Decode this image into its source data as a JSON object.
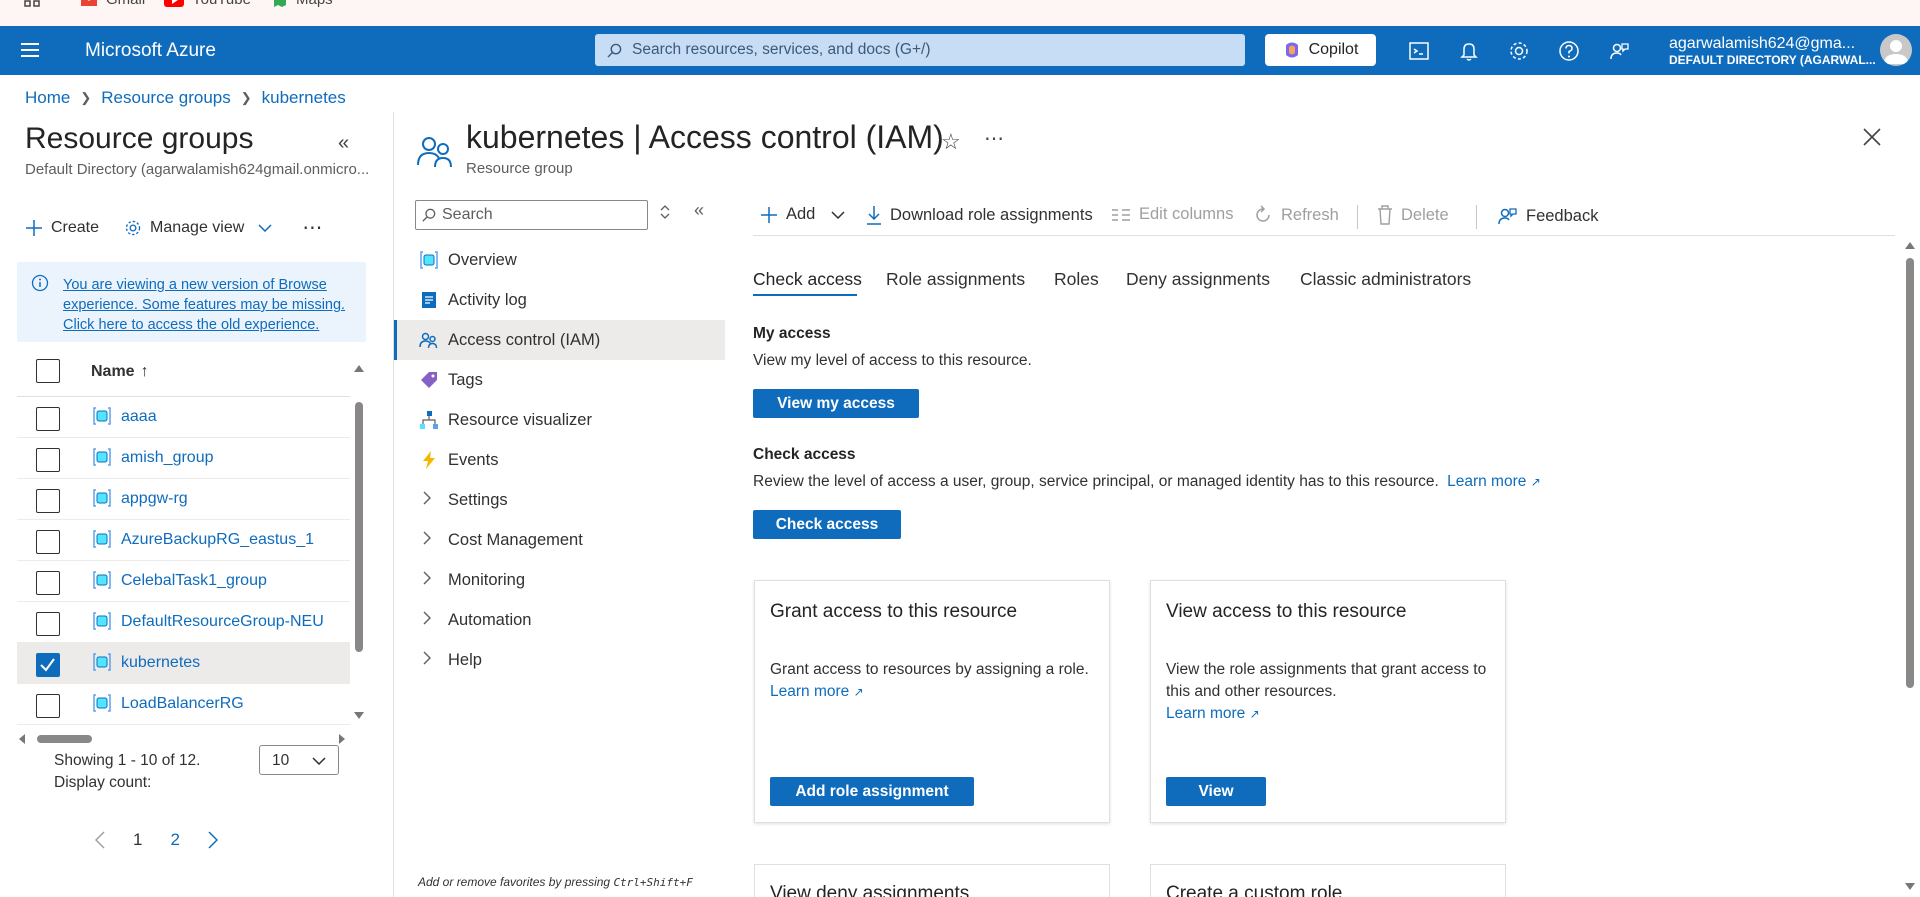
{
  "bookmarks": [
    {
      "label": "Gmail",
      "icon": "gmail-icon"
    },
    {
      "label": "YouTube",
      "icon": "youtube-icon"
    },
    {
      "label": "Maps",
      "icon": "maps-icon"
    }
  ],
  "header": {
    "brand": "Microsoft Azure",
    "search_placeholder": "Search resources, services, and docs (G+/)",
    "copilot_label": "Copilot",
    "account_email": "agarwalamish624@gma...",
    "account_directory": "DEFAULT DIRECTORY (AGARWAL..."
  },
  "breadcrumb": [
    "Home",
    "Resource groups",
    "kubernetes"
  ],
  "left_panel": {
    "title": "Resource groups",
    "subtitle": "Default Directory (agarwalamish624gmail.onmicro...",
    "create_label": "Create",
    "manage_view_label": "Manage view",
    "info_text": "You are viewing a new version of Browse experience. Some features may be missing. Click here to access the old experience.",
    "column_name": "Name",
    "rows": [
      {
        "name": "aaaa",
        "checked": false
      },
      {
        "name": "amish_group",
        "checked": false
      },
      {
        "name": "appgw-rg",
        "checked": false
      },
      {
        "name": "AzureBackupRG_eastus_1",
        "checked": false
      },
      {
        "name": "CelebalTask1_group",
        "checked": false
      },
      {
        "name": "DefaultResourceGroup-NEU",
        "checked": false
      },
      {
        "name": "kubernetes",
        "checked": true
      },
      {
        "name": "LoadBalancerRG",
        "checked": false
      }
    ],
    "showing_text": "Showing 1 - 10 of 12.",
    "display_count_label": "Display count:",
    "display_count_value": "10",
    "pages": [
      "1",
      "2"
    ]
  },
  "main": {
    "title": "kubernetes | Access control (IAM)",
    "subtitle": "Resource group",
    "menu_search_placeholder": "Search",
    "menu": [
      {
        "label": "Overview",
        "icon": "overview-icon"
      },
      {
        "label": "Activity log",
        "icon": "activity-log-icon"
      },
      {
        "label": "Access control (IAM)",
        "icon": "iam-icon",
        "active": true
      },
      {
        "label": "Tags",
        "icon": "tag-icon"
      },
      {
        "label": "Resource visualizer",
        "icon": "visualizer-icon"
      },
      {
        "label": "Events",
        "icon": "events-icon"
      },
      {
        "label": "Settings",
        "expandable": true
      },
      {
        "label": "Cost Management",
        "expandable": true
      },
      {
        "label": "Monitoring",
        "expandable": true
      },
      {
        "label": "Automation",
        "expandable": true
      },
      {
        "label": "Help",
        "expandable": true
      }
    ],
    "menu_footer_prefix": "Add or remove favorites by pressing",
    "menu_footer_shortcut": "Ctrl+Shift+F",
    "commands": {
      "add": "Add",
      "download": "Download role assignments",
      "edit_columns": "Edit columns",
      "refresh": "Refresh",
      "delete": "Delete",
      "feedback": "Feedback"
    },
    "tabs": [
      "Check access",
      "Role assignments",
      "Roles",
      "Deny assignments",
      "Classic administrators"
    ],
    "my_access": {
      "heading": "My access",
      "text": "View my level of access to this resource.",
      "button": "View my access"
    },
    "check_access": {
      "heading": "Check access",
      "text": "Review the level of access a user, group, service principal, or managed identity has to this resource.",
      "learn_more": "Learn more",
      "button": "Check access"
    },
    "cards": [
      {
        "title": "Grant access to this resource",
        "text": "Grant access to resources by assigning a role.",
        "learn_more": "Learn more",
        "button": "Add role assignment"
      },
      {
        "title": "View access to this resource",
        "text": "View the role assignments that grant access to this and other resources.",
        "learn_more": "Learn more",
        "button": "View"
      }
    ],
    "cards_below": [
      "View deny assignments",
      "Create a custom role"
    ]
  },
  "colors": {
    "azure_blue": "#0f6cbd",
    "link": "#0f6cbd"
  }
}
